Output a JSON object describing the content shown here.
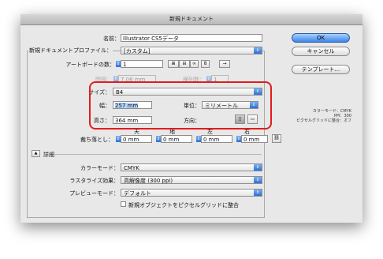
{
  "window": {
    "title": "新規ドキュメント"
  },
  "name": {
    "label": "名前：",
    "value": "Illustrator CS5データ"
  },
  "profile": {
    "label": "新規ドキュメントプロファイル：",
    "value": "[カスタム]"
  },
  "artboards": {
    "count_label": "アートボードの数：",
    "count_value": "1",
    "spacing_label": "間隔：",
    "spacing_value": "7.06 mm",
    "columns_label": "横列数：",
    "columns_value": "1",
    "arrow_glyph": "→"
  },
  "size": {
    "label": "サイズ：",
    "value": "B4"
  },
  "width": {
    "label": "幅：",
    "value": "257 mm"
  },
  "units": {
    "label": "単位：",
    "value": "ミリメートル"
  },
  "height": {
    "label": "高さ：",
    "value": "364 mm"
  },
  "orientation": {
    "label": "方向："
  },
  "bleed": {
    "label": "裁ち落とし：",
    "columns": [
      "天",
      "地",
      "左",
      "右"
    ],
    "values": [
      "0 mm",
      "0 mm",
      "0 mm",
      "0 mm"
    ]
  },
  "advanced": {
    "label": "詳細",
    "color_mode_label": "カラーモード：",
    "color_mode_value": "CMYK",
    "raster_label": "ラスタライズ効果：",
    "raster_value": "高解像度 (300 ppi)",
    "preview_label": "プレビューモード：",
    "preview_value": "デフォルト",
    "align_pixel_label": "新規オブジェクトをピクセルグリッドに整合"
  },
  "buttons": {
    "ok": "OK",
    "cancel": "キャンセル",
    "templates": "テンプレート..."
  },
  "summary": {
    "line1": "カラーモード：CMYK",
    "line2": "PPI：300",
    "line3": "ピクセルグリッドに整合：オフ"
  },
  "colors": {
    "accent": "#3b86e8",
    "highlight": "#e31c1c"
  }
}
